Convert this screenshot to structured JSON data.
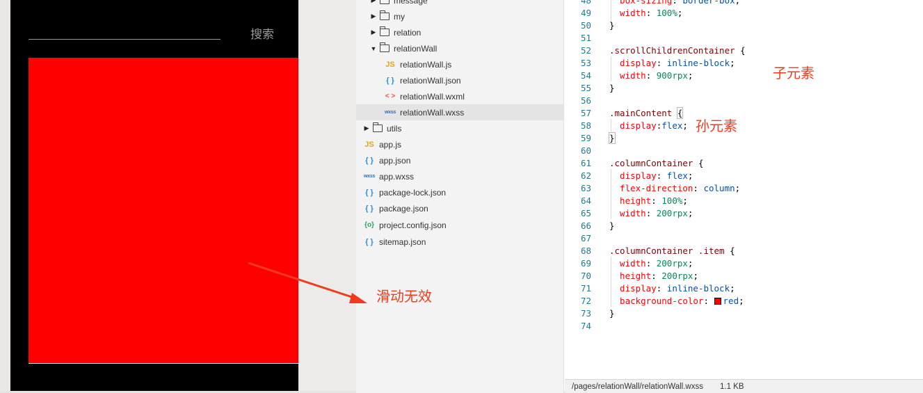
{
  "simulator": {
    "search_button": "搜索",
    "content_color": "#ff0000"
  },
  "file_tree": {
    "items": [
      {
        "label": "message",
        "type": "folder",
        "expanded": false,
        "indent": 1
      },
      {
        "label": "my",
        "type": "folder",
        "expanded": false,
        "indent": 1
      },
      {
        "label": "relation",
        "type": "folder",
        "expanded": false,
        "indent": 1
      },
      {
        "label": "relationWall",
        "type": "folder",
        "expanded": true,
        "indent": 1
      },
      {
        "label": "relationWall.js",
        "type": "js",
        "icon": "js-file-icon",
        "indent": 2
      },
      {
        "label": "relationWall.json",
        "type": "json",
        "icon": "json-file-icon",
        "indent": 2
      },
      {
        "label": "relationWall.wxml",
        "type": "wxml",
        "icon": "wxml-file-icon",
        "indent": 2
      },
      {
        "label": "relationWall.wxss",
        "type": "wxss",
        "icon": "wxss-file-icon",
        "indent": 2,
        "selected": true
      },
      {
        "label": "utils",
        "type": "folder",
        "expanded": false,
        "indent": 0
      },
      {
        "label": "app.js",
        "type": "js",
        "icon": "js-file-icon",
        "indent": 0
      },
      {
        "label": "app.json",
        "type": "json",
        "icon": "json-file-icon",
        "indent": 0
      },
      {
        "label": "app.wxss",
        "type": "wxss",
        "icon": "wxss-file-icon",
        "indent": 0
      },
      {
        "label": "package-lock.json",
        "type": "json",
        "icon": "json-file-icon",
        "indent": 0
      },
      {
        "label": "package.json",
        "type": "json",
        "icon": "json-file-icon",
        "indent": 0
      },
      {
        "label": "project.config.json",
        "type": "config",
        "icon": "config-file-icon",
        "indent": 0
      },
      {
        "label": "sitemap.json",
        "type": "json",
        "icon": "json-file-icon",
        "indent": 0
      }
    ],
    "icon_glyphs": {
      "js": "JS",
      "json": "{ }",
      "wxml": "< >",
      "wxss": "wxss",
      "config": "{o}"
    }
  },
  "editor": {
    "lines": [
      {
        "n": "48",
        "tokens": [
          [
            "prop",
            "  box-sizing"
          ],
          [
            "punc",
            ": "
          ],
          [
            "val",
            "border-box"
          ],
          [
            "punc",
            ";"
          ]
        ]
      },
      {
        "n": "49",
        "tokens": [
          [
            "prop",
            "  width"
          ],
          [
            "punc",
            ": "
          ],
          [
            "num",
            "100%"
          ],
          [
            "punc",
            ";"
          ]
        ]
      },
      {
        "n": "50",
        "tokens": [
          [
            "punc",
            "}"
          ]
        ]
      },
      {
        "n": "51",
        "tokens": []
      },
      {
        "n": "52",
        "tokens": [
          [
            "sel",
            ".scrollChildrenContainer"
          ],
          [
            "punc",
            " {"
          ]
        ]
      },
      {
        "n": "53",
        "tokens": [
          [
            "prop",
            "  display"
          ],
          [
            "punc",
            ": "
          ],
          [
            "val",
            "inline-block"
          ],
          [
            "punc",
            ";"
          ]
        ]
      },
      {
        "n": "54",
        "tokens": [
          [
            "prop",
            "  width"
          ],
          [
            "punc",
            ": "
          ],
          [
            "num",
            "900rpx"
          ],
          [
            "punc",
            ";"
          ]
        ]
      },
      {
        "n": "55",
        "tokens": [
          [
            "punc",
            "}"
          ]
        ]
      },
      {
        "n": "56",
        "tokens": []
      },
      {
        "n": "57",
        "tokens": [
          [
            "sel",
            ".mainContent"
          ],
          [
            "punc",
            " "
          ],
          [
            "brace",
            "{"
          ]
        ]
      },
      {
        "n": "58",
        "tokens": [
          [
            "prop",
            "  display"
          ],
          [
            "punc",
            ":"
          ],
          [
            "val",
            "flex"
          ],
          [
            "punc",
            ";"
          ]
        ]
      },
      {
        "n": "59",
        "tokens": [
          [
            "brace",
            "}"
          ]
        ]
      },
      {
        "n": "60",
        "tokens": []
      },
      {
        "n": "61",
        "tokens": [
          [
            "sel",
            ".columnContainer"
          ],
          [
            "punc",
            " {"
          ]
        ]
      },
      {
        "n": "62",
        "tokens": [
          [
            "prop",
            "  display"
          ],
          [
            "punc",
            ": "
          ],
          [
            "val",
            "flex"
          ],
          [
            "punc",
            ";"
          ]
        ]
      },
      {
        "n": "63",
        "tokens": [
          [
            "prop",
            "  flex-direction"
          ],
          [
            "punc",
            ": "
          ],
          [
            "val",
            "column"
          ],
          [
            "punc",
            ";"
          ]
        ]
      },
      {
        "n": "64",
        "tokens": [
          [
            "prop",
            "  height"
          ],
          [
            "punc",
            ": "
          ],
          [
            "num",
            "100%"
          ],
          [
            "punc",
            ";"
          ]
        ]
      },
      {
        "n": "65",
        "tokens": [
          [
            "prop",
            "  width"
          ],
          [
            "punc",
            ": "
          ],
          [
            "num",
            "200rpx"
          ],
          [
            "punc",
            ";"
          ]
        ]
      },
      {
        "n": "66",
        "tokens": [
          [
            "punc",
            "}"
          ]
        ]
      },
      {
        "n": "67",
        "tokens": []
      },
      {
        "n": "68",
        "tokens": [
          [
            "sel",
            ".columnContainer .item"
          ],
          [
            "punc",
            " {"
          ]
        ]
      },
      {
        "n": "69",
        "tokens": [
          [
            "prop",
            "  width"
          ],
          [
            "punc",
            ": "
          ],
          [
            "num",
            "200rpx"
          ],
          [
            "punc",
            ";"
          ]
        ]
      },
      {
        "n": "70",
        "tokens": [
          [
            "prop",
            "  height"
          ],
          [
            "punc",
            ": "
          ],
          [
            "num",
            "200rpx"
          ],
          [
            "punc",
            ";"
          ]
        ]
      },
      {
        "n": "71",
        "tokens": [
          [
            "prop",
            "  display"
          ],
          [
            "punc",
            ": "
          ],
          [
            "val",
            "inline-block"
          ],
          [
            "punc",
            ";"
          ]
        ]
      },
      {
        "n": "72",
        "tokens": [
          [
            "prop",
            "  background-color"
          ],
          [
            "punc",
            ": "
          ],
          [
            "swatch",
            ""
          ],
          [
            "val",
            "red"
          ],
          [
            "punc",
            ";"
          ]
        ]
      },
      {
        "n": "73",
        "tokens": [
          [
            "punc",
            "}"
          ]
        ]
      },
      {
        "n": "74",
        "tokens": []
      }
    ]
  },
  "status_bar": {
    "path": "/pages/relationWall/relationWall.wxss",
    "size": "1.1 KB"
  },
  "annotations": {
    "child_element": "子元素",
    "grandchild_element": "孙元素",
    "scroll_invalid": "滑动无效",
    "color": "#f23a1e"
  }
}
